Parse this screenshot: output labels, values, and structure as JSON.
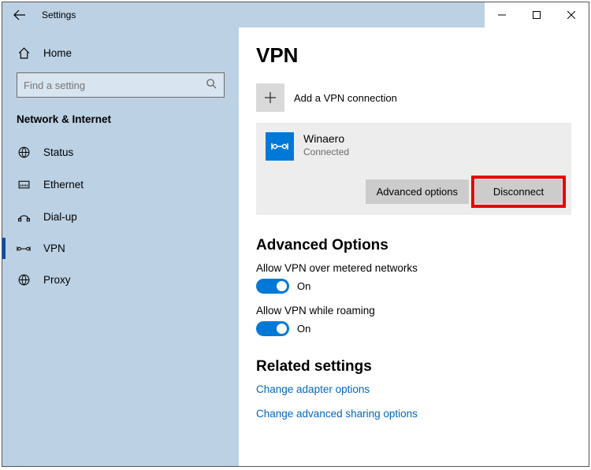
{
  "titlebar": {
    "title": "Settings"
  },
  "sidebar": {
    "home_label": "Home",
    "search_placeholder": "Find a setting",
    "section_title": "Network & Internet",
    "items": [
      {
        "label": "Status"
      },
      {
        "label": "Ethernet"
      },
      {
        "label": "Dial-up"
      },
      {
        "label": "VPN"
      },
      {
        "label": "Proxy"
      }
    ]
  },
  "main": {
    "heading": "VPN",
    "add_label": "Add a VPN connection",
    "connection": {
      "name": "Winaero",
      "status": "Connected",
      "advanced_label": "Advanced options",
      "disconnect_label": "Disconnect"
    },
    "advanced_heading": "Advanced Options",
    "toggles": [
      {
        "label": "Allow VPN over metered networks",
        "state": "On"
      },
      {
        "label": "Allow VPN while roaming",
        "state": "On"
      }
    ],
    "related_heading": "Related settings",
    "links": [
      "Change adapter options",
      "Change advanced sharing options"
    ]
  }
}
